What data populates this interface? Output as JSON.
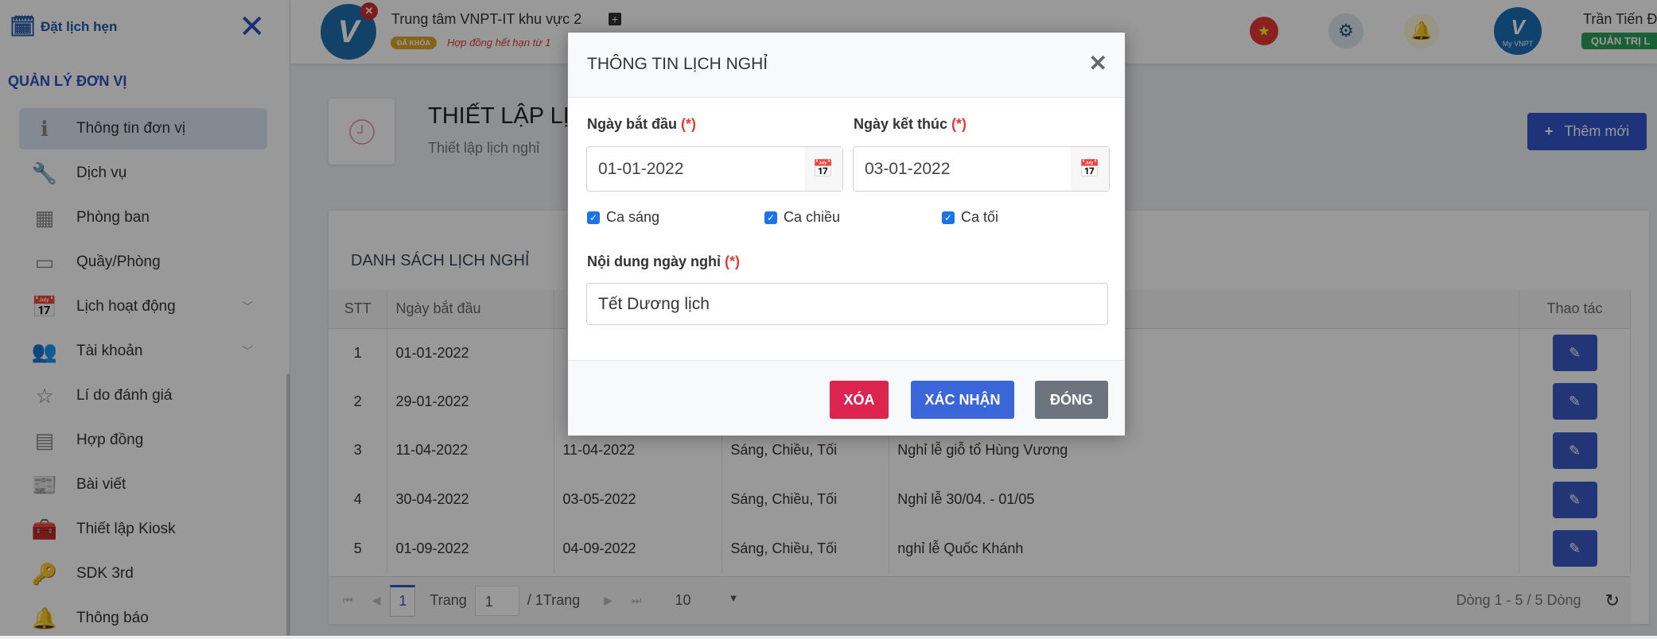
{
  "sidebar": {
    "brand": "Đặt lịch hẹn",
    "section": "QUẢN LÝ ĐƠN VỊ",
    "items": [
      {
        "label": "Thông tin đơn vị",
        "icon": "info-icon",
        "glyph": "ℹ",
        "active": true
      },
      {
        "label": "Dịch vụ",
        "icon": "wrench-icon",
        "glyph": "🔧"
      },
      {
        "label": "Phòng ban",
        "icon": "building-icon",
        "glyph": "▦"
      },
      {
        "label": "Quầy/Phòng",
        "icon": "archive-icon",
        "glyph": "▭"
      },
      {
        "label": "Lịch hoạt động",
        "icon": "calendar-x-icon",
        "glyph": "📅",
        "expandable": true
      },
      {
        "label": "Tài khoản",
        "icon": "users-icon",
        "glyph": "👥",
        "expandable": true
      },
      {
        "label": "Lí do đánh giá",
        "icon": "star-icon",
        "glyph": "☆"
      },
      {
        "label": "Hợp đồng",
        "icon": "document-icon",
        "glyph": "▤"
      },
      {
        "label": "Bài viết",
        "icon": "newspaper-icon",
        "glyph": "📰"
      },
      {
        "label": "Thiết lập Kiosk",
        "icon": "toolbox-icon",
        "glyph": "🧰"
      },
      {
        "label": "SDK 3rd",
        "icon": "key-icon",
        "glyph": "🔑"
      },
      {
        "label": "Thông báo",
        "icon": "bell-icon",
        "glyph": "🔔"
      }
    ]
  },
  "topbar": {
    "org_name": "Trung tâm VNPT-IT khu vực 2",
    "lock_badge": "ĐÃ KHÓA",
    "expire_text": "Hợp đồng hết hạn từ 1",
    "user_name": "Trần Tiến Đ",
    "role": "QUẢN TRỊ L",
    "myvnpt": "My VNPT"
  },
  "page": {
    "title": "THIẾT LẬP LỊ",
    "subtitle": "Thiết lập lịch nghỉ",
    "add_button": "Thêm mới"
  },
  "list": {
    "title": "DANH SÁCH LỊCH NGHỈ",
    "columns": [
      "STT",
      "Ngày bắt đầu",
      "",
      "",
      "",
      "Thao tác"
    ],
    "rows": [
      [
        "1",
        "01-01-2022",
        "",
        "",
        "",
        ""
      ],
      [
        "2",
        "29-01-2022",
        "",
        "",
        "",
        ""
      ],
      [
        "3",
        "11-04-2022",
        "11-04-2022",
        "Sáng, Chiều, Tối",
        "Nghỉ lễ giỗ tổ Hùng Vương",
        ""
      ],
      [
        "4",
        "30-04-2022",
        "03-05-2022",
        "Sáng, Chiều, Tối",
        "Nghỉ lễ 30/04. - 01/05",
        ""
      ],
      [
        "5",
        "01-09-2022",
        "04-09-2022",
        "Sáng, Chiều, Tối",
        "nghỉ lễ Quốc Khánh",
        ""
      ]
    ]
  },
  "pager": {
    "current": "1",
    "page_label": "Trang",
    "page_value": "1",
    "total": "/ 1Trang",
    "page_size": "10",
    "summary": "Dòng  1 - 5 / 5  Dòng"
  },
  "modal": {
    "title": "THÔNG TIN LỊCH NGHỈ",
    "start_label": "Ngày bắt đầu",
    "end_label": "Ngày kết thúc",
    "required": "(*)",
    "start_value": "01-01-2022",
    "end_value": "03-01-2022",
    "shifts": [
      {
        "label": "Ca sáng",
        "checked": true
      },
      {
        "label": "Ca chiều",
        "checked": true
      },
      {
        "label": "Ca tối",
        "checked": true
      }
    ],
    "content_label": "Nội dung ngày nghỉ",
    "content_value": "Tết Dương lịch",
    "delete": "XÓA",
    "confirm": "XÁC NHẬN",
    "close": "ĐÓNG"
  },
  "colors": {
    "primary": "#3355cc",
    "danger": "#dc2450",
    "confirm": "#3b66d9",
    "secondary": "#6c757d",
    "success": "#2e9e5b"
  }
}
